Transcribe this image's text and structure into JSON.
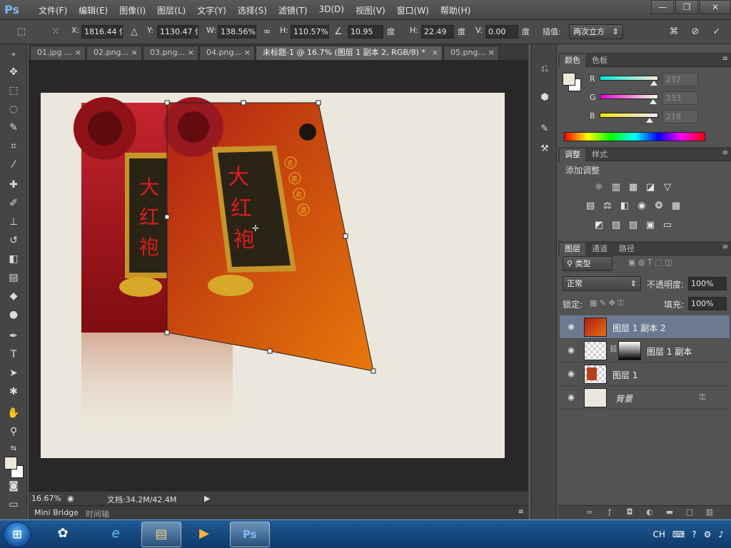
{
  "app": {
    "logo": "Ps"
  },
  "menu": [
    "文件(F)",
    "编辑(E)",
    "图像(I)",
    "图层(L)",
    "文字(Y)",
    "选择(S)",
    "滤镜(T)",
    "3D(D)",
    "视图(V)",
    "窗口(W)",
    "帮助(H)"
  ],
  "window_buttons": {
    "minimize": "—",
    "restore": "❐",
    "close": "✕"
  },
  "options": {
    "x_label": "X:",
    "x_value": "1816.44 像",
    "y_label": "Y:",
    "y_value": "1130.47 像",
    "w_label": "W:",
    "w_value": "138.56%",
    "h_label": "H:",
    "h_value": "110.57%",
    "angle_value": "10.95",
    "angle_unit": "度",
    "hskew_label": "H:",
    "hskew_value": "22.49",
    "hskew_unit": "度",
    "vskew_label": "V:",
    "vskew_value": "0.00",
    "vskew_unit": "度",
    "interp_label": "插值:",
    "interp_value": "两次立方"
  },
  "tabs": [
    {
      "label": "01.jpg ...",
      "close": "×"
    },
    {
      "label": "02.png...",
      "close": "×"
    },
    {
      "label": "03.png...",
      "close": "×"
    },
    {
      "label": "04.png...",
      "close": "×"
    },
    {
      "label": "未标题-1 @ 16.7% (图层 1 副本 2, RGB/8) *",
      "close": "×"
    },
    {
      "label": "05.png...",
      "close": "×"
    }
  ],
  "artwork": {
    "title_chars": [
      "大",
      "红",
      "袍"
    ],
    "seal_chars": [
      "名",
      "茶",
      "名",
      "酒"
    ]
  },
  "status": {
    "zoom": "16.67%",
    "doc": "文档:34.2M/42.4M"
  },
  "bottom_tabs": {
    "minibridge": "Mini Bridge",
    "timeline": "时间轴"
  },
  "color_panel": {
    "tabs": [
      "颜色",
      "色板"
    ],
    "r_label": "R",
    "g_label": "G",
    "b_label": "B",
    "r_value": "237",
    "g_value": "233",
    "b_value": "218",
    "r_fraction": 0.93,
    "g_fraction": 0.91,
    "b_fraction": 0.85,
    "foreground": "#ede9da",
    "background": "#ffffff"
  },
  "adjustments_panel": {
    "tabs": [
      "调整",
      "样式"
    ],
    "title": "添加调整"
  },
  "layers_panel": {
    "tabs": [
      "图层",
      "通道",
      "路径"
    ],
    "filter_label": "类型",
    "blend_mode": "正常",
    "opacity_label": "不透明度:",
    "opacity_value": "100%",
    "lock_label": "锁定:",
    "fill_label": "填充:",
    "fill_value": "100%",
    "layers": [
      {
        "name": "图层 1 副本 2",
        "selected": true
      },
      {
        "name": "图层 1 副本",
        "selected": false
      },
      {
        "name": "图层 1",
        "selected": false
      },
      {
        "name": "背景",
        "selected": false
      }
    ]
  },
  "taskbar": {
    "lang": "CH",
    "ps_label": "Ps"
  },
  "colors": {
    "accent": "#6b7a90",
    "selected_tab": "#5f5f5f"
  }
}
